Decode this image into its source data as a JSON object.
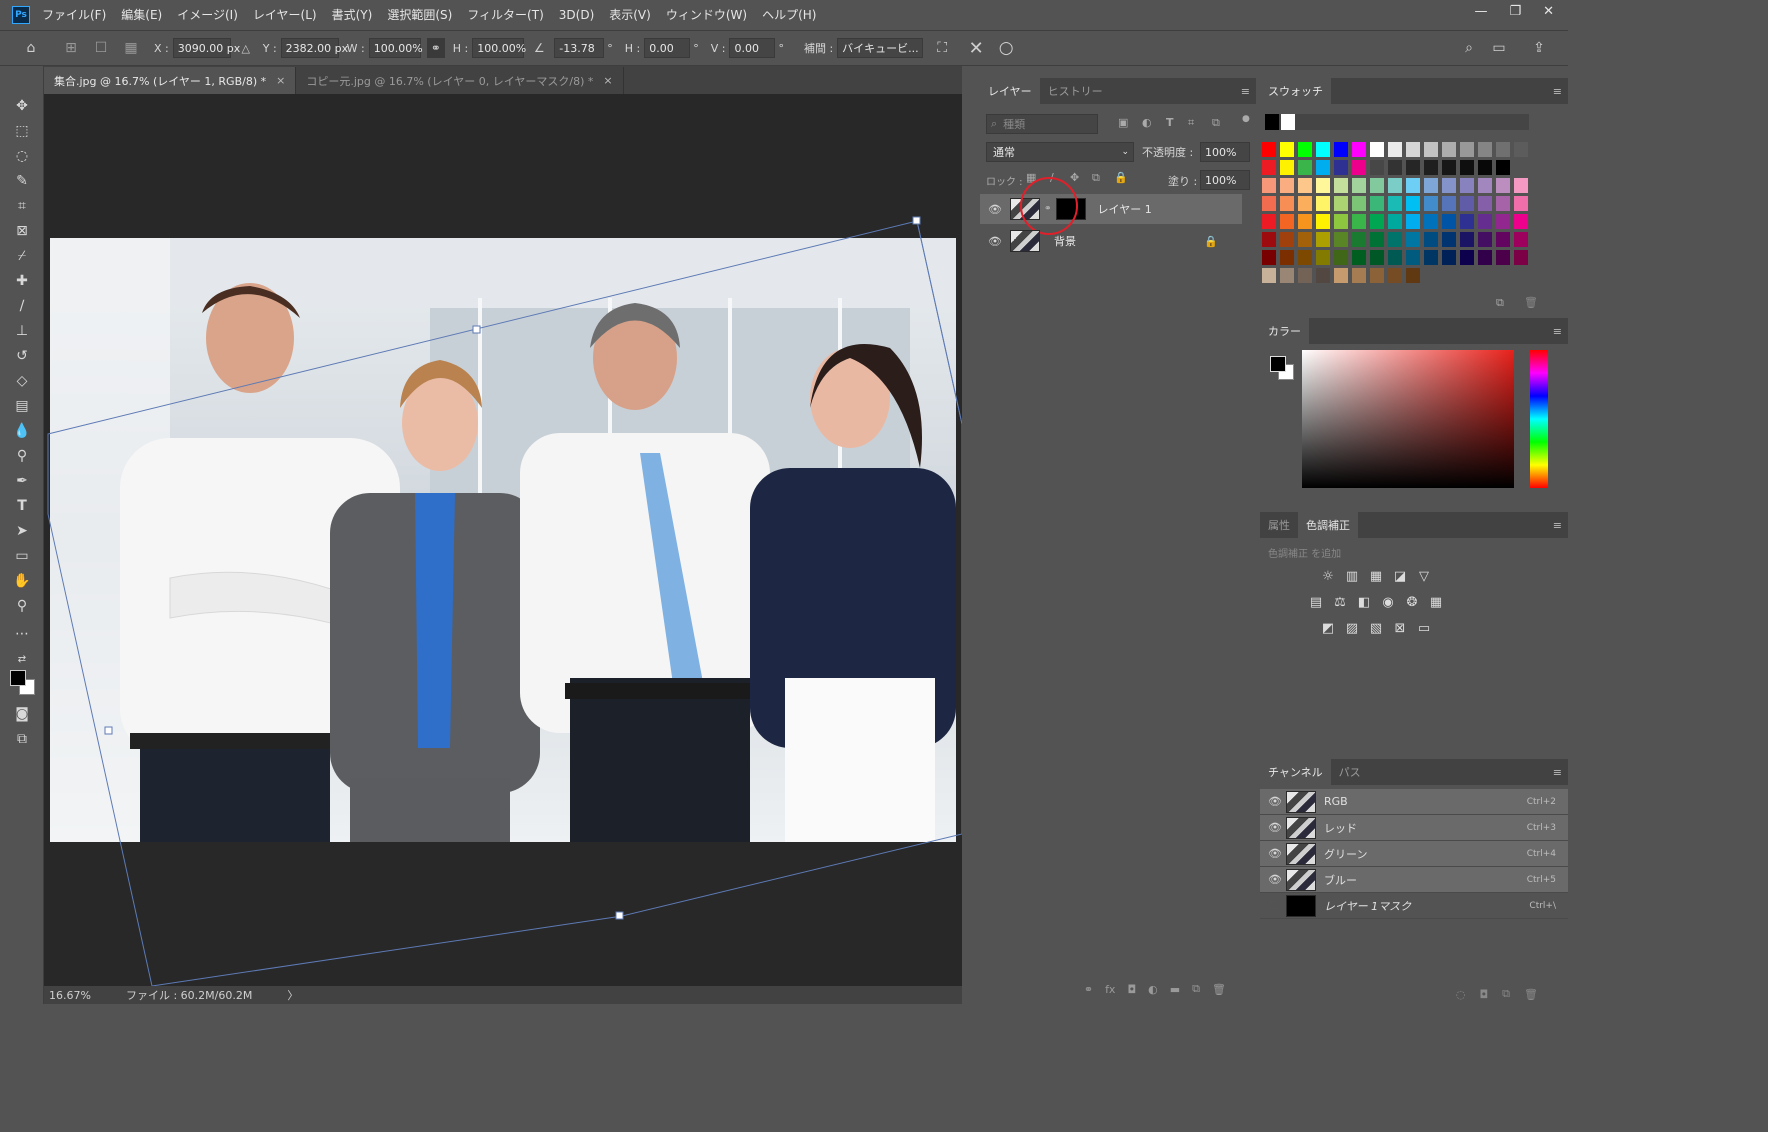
{
  "app": {
    "logo": "Ps"
  },
  "menu": [
    "ファイル(F)",
    "編集(E)",
    "イメージ(I)",
    "レイヤー(L)",
    "書式(Y)",
    "選択範囲(S)",
    "フィルター(T)",
    "3D(D)",
    "表示(V)",
    "ウィンドウ(W)",
    "ヘルプ(H)"
  ],
  "window_controls": {
    "minimize": "—",
    "restore": "❐",
    "close": "✕"
  },
  "options": {
    "x_label": "X :",
    "x_value": "3090.00 px",
    "y_label": "Y :",
    "y_value": "2382.00 px",
    "w_label": "W :",
    "w_value": "100.00%",
    "h_label": "H :",
    "h_value": "100.00%",
    "angle_value": "-13.78",
    "degree": "°",
    "hskew_label": "H :",
    "hskew_value": "0.00",
    "vskew_label": "V :",
    "vskew_value": "0.00",
    "interp_label": "補間 :",
    "interp_value": "バイキュービ..."
  },
  "doc_tabs": [
    {
      "label": "集合.jpg @ 16.7% (レイヤー 1, RGB/8) *",
      "close": "×"
    },
    {
      "label": "コピー元.jpg @ 16.7% (レイヤー 0, レイヤーマスク/8) *",
      "close": "×"
    }
  ],
  "status": {
    "zoom": "16.67%",
    "file": "ファイル : 60.2M/60.2M",
    "arrow": "〉"
  },
  "layers_panel": {
    "tabs": [
      "レイヤー",
      "ヒストリー"
    ],
    "search_placeholder": "種類",
    "blend_mode": "通常",
    "opacity_label": "不透明度 :",
    "opacity_value": "100%",
    "lock_label": "ロック :",
    "fill_label": "塗り :",
    "fill_value": "100%",
    "layers": [
      {
        "name": "レイヤー 1"
      },
      {
        "name": "背景"
      }
    ]
  },
  "swatches_panel": {
    "tab": "スウォッチ",
    "colors": [
      [
        "#ff0000",
        "#ffff00",
        "#00ff00",
        "#00ffff",
        "#0000ff",
        "#ff00ff",
        "#ffffff",
        "#ebebeb",
        "#d6d6d6",
        "#c2c2c2",
        "#adadad",
        "#999999",
        "#858585",
        "#707070",
        "#5c5c5c"
      ],
      [
        "#ed1c24",
        "#fff200",
        "#39b54a",
        "#00aeef",
        "#2e3192",
        "#ec008c",
        "#474747",
        "#333333",
        "#262626",
        "#1f1f1f",
        "#171717",
        "#0f0f0f",
        "#080808",
        "#000000",
        ""
      ],
      [
        "#f7977a",
        "#f9ad81",
        "#fdc68a",
        "#fff79a",
        "#c4df9b",
        "#a3d39c",
        "#82ca9d",
        "#7bcdc8",
        "#6ecff6",
        "#7ea7d8",
        "#8493ca",
        "#8882be",
        "#a187be",
        "#bc8dbf",
        "#f49ac2"
      ],
      [
        "#f26c4f",
        "#f68e55",
        "#fbaf5c",
        "#fff467",
        "#acd372",
        "#7cc576",
        "#3bb878",
        "#1abbb4",
        "#00bff3",
        "#438ccb",
        "#5574b9",
        "#605ca8",
        "#855fa8",
        "#a763a8",
        "#f06ea9"
      ],
      [
        "#ed1c24",
        "#f26522",
        "#f7941d",
        "#fff200",
        "#8dc63f",
        "#39b54a",
        "#00a651",
        "#00a99d",
        "#00aeef",
        "#0072bc",
        "#0054a6",
        "#2e3192",
        "#662d91",
        "#92278f",
        "#ec008c"
      ],
      [
        "#9e0b0f",
        "#a0410d",
        "#a36209",
        "#aba000",
        "#598527",
        "#1a7b30",
        "#007236",
        "#00746b",
        "#0076a3",
        "#004b80",
        "#003471",
        "#1b1464",
        "#440e62",
        "#630460",
        "#9e005d"
      ],
      [
        "#790000",
        "#7b2e00",
        "#7d4900",
        "#827b00",
        "#406618",
        "#005e20",
        "#005826",
        "#005952",
        "#005b7f",
        "#003663",
        "#002157",
        "#0d004c",
        "#32004b",
        "#4b0049",
        "#7b0046"
      ],
      [
        "#c7b299",
        "#998675",
        "#736357",
        "#534741",
        "#c69c6e",
        "#a67c52",
        "#8c6239",
        "#754c24",
        "#603913",
        "",
        "",
        "",
        "",
        "",
        ""
      ]
    ]
  },
  "color_panel": {
    "tab": "カラー"
  },
  "adjust_panel": {
    "tabs": [
      "属性",
      "色調補正"
    ],
    "hint": "色調補正 を追加",
    "icons": [
      [
        "☼",
        "▥",
        "▦",
        "◪",
        "▽"
      ],
      [
        "▤",
        "⚖",
        "◧",
        "◉",
        "❂",
        "▦"
      ],
      [
        "◩",
        "▨",
        "▧",
        "⊠",
        "▭"
      ]
    ]
  },
  "channels_panel": {
    "tabs": [
      "チャンネル",
      "パス"
    ],
    "channels": [
      {
        "name": "RGB",
        "shortcut": "Ctrl+2"
      },
      {
        "name": "レッド",
        "shortcut": "Ctrl+3"
      },
      {
        "name": "グリーン",
        "shortcut": "Ctrl+4"
      },
      {
        "name": "ブルー",
        "shortcut": "Ctrl+5"
      },
      {
        "name": "レイヤー 1マスク",
        "shortcut": "Ctrl+\\"
      }
    ]
  }
}
